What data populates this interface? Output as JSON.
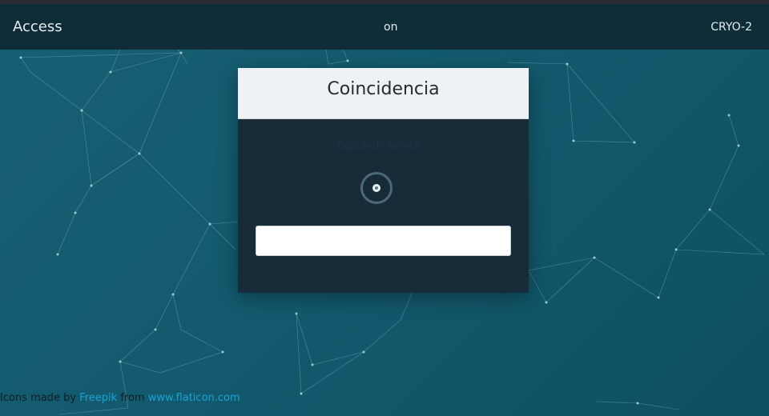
{
  "navbar": {
    "left_text": "Access",
    "center_text": "on",
    "right_text": "CRYO-2"
  },
  "modal": {
    "title": "Coincidencia",
    "faint_text": "Buscando tarjeta...",
    "spinner_icon": "loading-spinner-icon",
    "input_value": "",
    "input_placeholder": ""
  },
  "credits": {
    "prefix": "Icons made by",
    "author_link": "Freepik",
    "middle": "from",
    "site_link": "www.flaticon.com"
  },
  "colors": {
    "background": "#14586b",
    "navbar": "#0f2d38",
    "modal_body": "#172b39",
    "modal_header": "#eef2f5",
    "link": "#1aa3d6"
  }
}
